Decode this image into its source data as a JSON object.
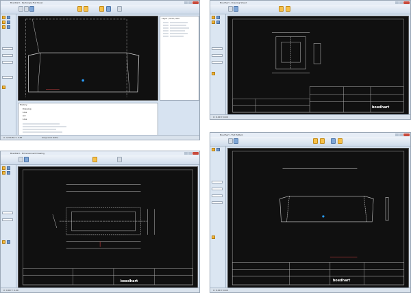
{
  "screens": [
    {
      "id": "ui-1",
      "window_title": "Boedhart - Rectangle Flat Panel",
      "grid_panel_title": "Layer / Grid / Info",
      "history_title": "History",
      "history_items": [
        "Drawing",
        "Line",
        "Arc",
        "Line"
      ],
      "status_left": "X: 1234.56 Y: 3.87",
      "status_right": "Snap Grid Ortho"
    },
    {
      "id": "ui-2",
      "window_title": "Boedhart - Drawing Sheet",
      "brand_logo_text": "boedhart",
      "status_left": "X: 0.00 Y: 0.00"
    },
    {
      "id": "ui-3",
      "window_title": "Boedhart - Dimensioned Drawing",
      "brand_logo_text": "boedhart",
      "status_left": "X: 0.00 Y: 0.00"
    },
    {
      "id": "ui-4",
      "window_title": "Boedhart - Flat Pattern",
      "brand_logo_text": "boedhart",
      "status_left": "X: 0.00 Y: 0.00"
    }
  ],
  "colors": {
    "canvas": "#101010",
    "cad_line": "#c8c8c8",
    "accent_orange": "#f6c04a",
    "accent_blue": "#7fa6d6",
    "red_dim": "#d04040",
    "marker_blue": "#2aa0ff"
  }
}
